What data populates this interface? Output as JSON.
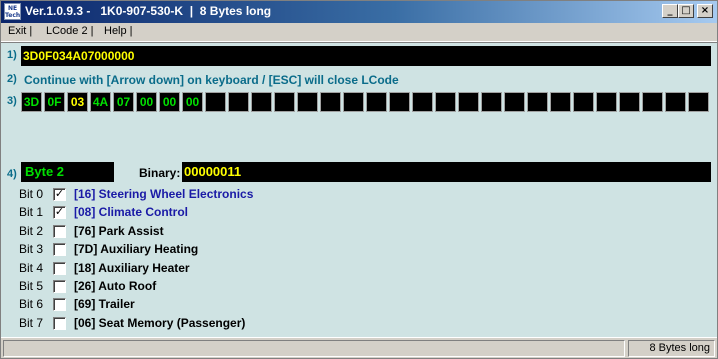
{
  "window": {
    "title": "Ver.1.0.9.3 -   1K0-907-530-K  |  8 Bytes long",
    "icon_text": [
      "NE",
      "Tech"
    ],
    "minimize_label": "_",
    "maximize_label": "□",
    "close_label": "×"
  },
  "menu": {
    "items": [
      "Exit |",
      "LCode 2 |",
      "Help |"
    ]
  },
  "step1": {
    "number": "1)",
    "code_value": "3D0F034A07000000"
  },
  "step2": {
    "number": "2)",
    "instruction": "Continue with [Arrow down] on keyboard / [ESC] will close LCode"
  },
  "step3": {
    "number": "3)",
    "bytes": [
      "3D",
      "0F",
      "03",
      "4A",
      "07",
      "00",
      "00",
      "00",
      "",
      "",
      "",
      "",
      "",
      "",
      "",
      "",
      "",
      "",
      "",
      "",
      "",
      "",
      "",
      "",
      "",
      "",
      "",
      "",
      "",
      ""
    ],
    "selected_byte_index": 2
  },
  "step4": {
    "number": "4)",
    "byte_label": "Byte 2",
    "binary_label": "Binary:",
    "binary_value": "00000011"
  },
  "bits": [
    {
      "label": "Bit 0",
      "checked": true,
      "mark": "✓",
      "text": "[16] Steering Wheel Electronics"
    },
    {
      "label": "Bit 1",
      "checked": true,
      "mark": "✓",
      "text": "[08] Climate Control"
    },
    {
      "label": "Bit 2",
      "checked": false,
      "mark": "",
      "text": "[76] Park Assist"
    },
    {
      "label": "Bit 3",
      "checked": false,
      "mark": "",
      "text": "[7D] Auxiliary Heating"
    },
    {
      "label": "Bit 4",
      "checked": false,
      "mark": "",
      "text": "[18] Auxiliary Heater"
    },
    {
      "label": "Bit 5",
      "checked": false,
      "mark": "",
      "text": "[26] Auto Roof"
    },
    {
      "label": "Bit 6",
      "checked": false,
      "mark": "",
      "text": "[69] Trailer"
    },
    {
      "label": "Bit 7",
      "checked": false,
      "mark": "",
      "text": "[06] Seat Memory (Passenger)"
    }
  ],
  "status": {
    "left": "",
    "right": "8 Bytes long"
  },
  "colors": {
    "client_bg": "#cfe3e3",
    "step_number": "#0a6c8a",
    "yellow_value": "#ffff00",
    "green_value": "#00e000",
    "active_bit_text": "#1a1aa6",
    "inactive_bit_text": "#000000"
  }
}
